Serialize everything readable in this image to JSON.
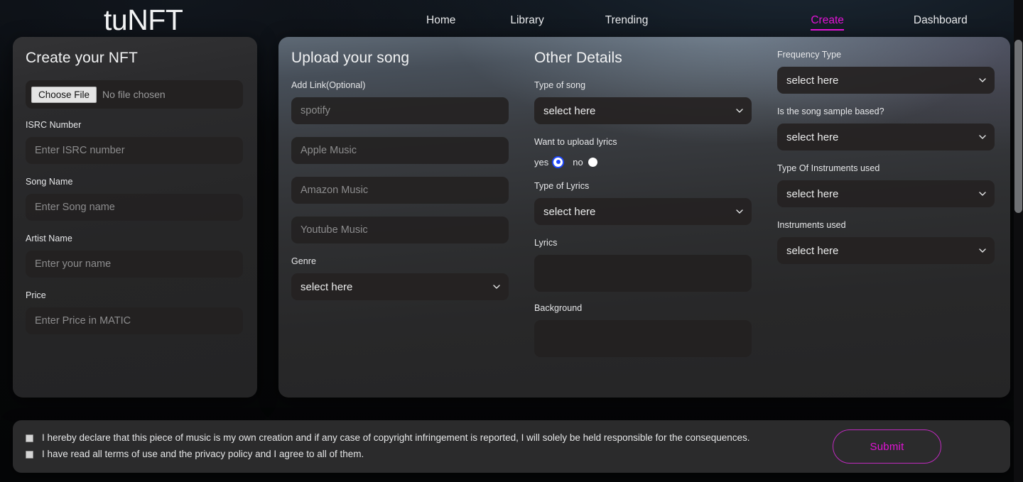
{
  "brand": "tuNFT",
  "nav": {
    "items": [
      {
        "label": "Home",
        "active": false
      },
      {
        "label": "Library",
        "active": false
      },
      {
        "label": "Trending",
        "active": false
      },
      {
        "label": "Create",
        "active": true
      },
      {
        "label": "Dashboard",
        "active": false
      }
    ],
    "active_color": "#e213d6"
  },
  "create_card": {
    "title": "Create your NFT",
    "file_input": {
      "button_label": "Choose File",
      "status": "No file chosen"
    },
    "fields": [
      {
        "label": "ISRC Number",
        "placeholder": "Enter ISRC number",
        "value": ""
      },
      {
        "label": "Song Name",
        "placeholder": "Enter Song name",
        "value": ""
      },
      {
        "label": "Artist Name",
        "placeholder": "Enter your name",
        "value": ""
      },
      {
        "label": "Price",
        "placeholder": "Enter Price in MATIC",
        "value": ""
      }
    ]
  },
  "upload_card": {
    "title": "Upload your song",
    "link_label": "Add Link(Optional)",
    "links": [
      {
        "placeholder": "spotify",
        "value": ""
      },
      {
        "placeholder": "Apple Music",
        "value": ""
      },
      {
        "placeholder": "Amazon Music",
        "value": ""
      },
      {
        "placeholder": "Youtube Music",
        "value": ""
      }
    ],
    "genre": {
      "label": "Genre",
      "selected": "select here",
      "caret_icon": "chevron-down-icon"
    }
  },
  "other_details": {
    "title": "Other Details",
    "type_of_song": {
      "label": "Type of song",
      "selected": "select here"
    },
    "upload_lyrics": {
      "label": "Want to upload lyrics",
      "yes_label": "yes",
      "no_label": "no",
      "selected": "yes"
    },
    "type_of_lyrics": {
      "label": "Type of Lyrics",
      "selected": "select here"
    },
    "lyrics": {
      "label": "Lyrics",
      "value": "",
      "placeholder": ""
    },
    "background": {
      "label": "Background",
      "value": "",
      "placeholder": ""
    }
  },
  "extra_details": {
    "frequency_type": {
      "label": "Frequency Type",
      "selected": "select here"
    },
    "sample_based": {
      "label": "Is the song sample based?",
      "selected": "select here"
    },
    "type_of_instruments": {
      "label": "Type Of Instruments used",
      "selected": "select here"
    },
    "instruments_used": {
      "label": "Instruments used",
      "selected": "select here"
    }
  },
  "agreement": {
    "declare_text": "I hereby declare that this piece of music is my own creation and if any case of copyright infringement is reported, I will solely be held responsible for the consequences.",
    "terms_text": "I have read all terms of use and the privacy policy and I agree to all of them.",
    "declare_checked": false,
    "terms_checked": false,
    "submit_label": "Submit",
    "submit_color": "#e213d6"
  }
}
